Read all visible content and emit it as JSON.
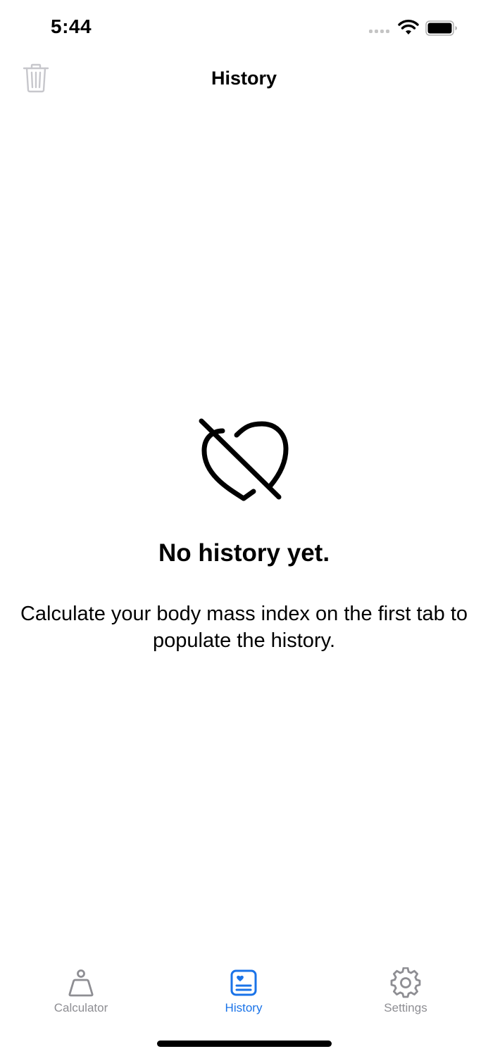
{
  "status_bar": {
    "time": "5:44",
    "icons": [
      "cellular-signal-icon",
      "wifi-icon",
      "battery-icon"
    ]
  },
  "nav": {
    "title": "History",
    "left_button_icon": "trash-icon"
  },
  "empty_state": {
    "icon": "heart-slash-icon",
    "title": "No history yet.",
    "message": "Calculate your body mass index on the first tab to populate the history."
  },
  "tab_bar": {
    "tabs": [
      {
        "label": "Calculator",
        "icon": "scale-weight-icon",
        "active": false
      },
      {
        "label": "History",
        "icon": "history-list-icon",
        "active": true
      },
      {
        "label": "Settings",
        "icon": "gear-icon",
        "active": false
      }
    ]
  },
  "colors": {
    "accent": "#1a73e8",
    "inactive": "#8e8e93",
    "disabled_icon": "#c7c7cc",
    "text": "#000000",
    "background": "#ffffff"
  }
}
